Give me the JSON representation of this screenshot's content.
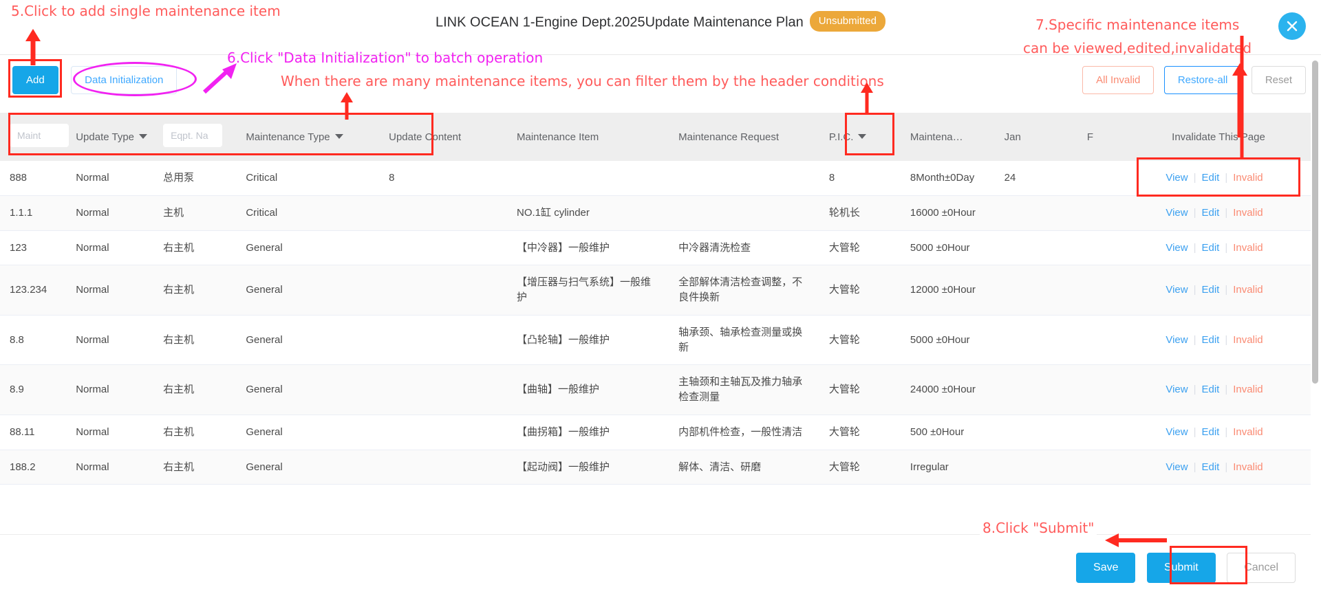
{
  "header": {
    "title": "LINK OCEAN 1-Engine Dept.2025Update Maintenance Plan",
    "status_badge": "Unsubmitted",
    "close_icon": "close-icon"
  },
  "toolbar": {
    "add_label": "Add",
    "data_init_label": "Data Initialization",
    "all_invalid_label": "All Invalid",
    "restore_all_label": "Restore-all",
    "reset_label": "Reset"
  },
  "table": {
    "headers": [
      {
        "label": "Maint",
        "type": "input",
        "placeholder": "Maint"
      },
      {
        "label": "Update Type",
        "type": "dropdown"
      },
      {
        "label": "Eqpt. Na",
        "type": "input",
        "placeholder": "Eqpt. Na"
      },
      {
        "label": "Maintenance Type",
        "type": "dropdown"
      },
      {
        "label": "Update Content",
        "type": "text"
      },
      {
        "label": "Maintenance Item",
        "type": "text"
      },
      {
        "label": "Maintenance Request",
        "type": "text"
      },
      {
        "label": "P.I.C.",
        "type": "dropdown"
      },
      {
        "label": "Maintena…",
        "type": "text"
      },
      {
        "label": "Jan",
        "type": "text"
      },
      {
        "label": "F",
        "type": "text"
      },
      {
        "label": "Invalidate This Page",
        "type": "action"
      }
    ],
    "action_labels": {
      "view": "View",
      "edit": "Edit",
      "invalid": "Invalid"
    },
    "rows": [
      {
        "id": "888",
        "update_type": "Normal",
        "eqpt": "总用泵",
        "maint_type": "Critical",
        "maint_type_critical": true,
        "update_content": "8",
        "maint_item": "",
        "maint_request": "",
        "pic": "8",
        "interval": "8Month±0Day",
        "jan": "24",
        "feb": ""
      },
      {
        "id": "1.1.1",
        "update_type": "Normal",
        "eqpt": "主机",
        "maint_type": "Critical",
        "maint_type_critical": true,
        "update_content": "",
        "maint_item": "NO.1缸 cylinder",
        "maint_request": "",
        "pic": "轮机长",
        "interval": "16000 ±0Hour",
        "jan": "",
        "feb": ""
      },
      {
        "id": "123",
        "update_type": "Normal",
        "eqpt": "右主机",
        "maint_type": "General",
        "maint_type_critical": false,
        "update_content": "",
        "maint_item": "【中冷器】一般维护",
        "maint_request": "中冷器清洗检查",
        "pic": "大管轮",
        "interval": "5000 ±0Hour",
        "jan": "",
        "feb": ""
      },
      {
        "id": "123.234",
        "update_type": "Normal",
        "eqpt": "右主机",
        "maint_type": "General",
        "maint_type_critical": false,
        "update_content": "",
        "maint_item": "【增压器与扫气系统】一般维护",
        "maint_request": "全部解体清洁检查调整，不良件换新",
        "pic": "大管轮",
        "interval": "12000 ±0Hour",
        "jan": "",
        "feb": ""
      },
      {
        "id": "8.8",
        "update_type": "Normal",
        "eqpt": "右主机",
        "maint_type": "General",
        "maint_type_critical": false,
        "update_content": "",
        "maint_item": "【凸轮轴】一般维护",
        "maint_request": "轴承颈、轴承检查测量或换新",
        "pic": "大管轮",
        "interval": "5000 ±0Hour",
        "jan": "",
        "feb": ""
      },
      {
        "id": "8.9",
        "update_type": "Normal",
        "eqpt": "右主机",
        "maint_type": "General",
        "maint_type_critical": false,
        "update_content": "",
        "maint_item": "【曲轴】一般维护",
        "maint_request": "主轴颈和主轴瓦及推力轴承检查测量",
        "pic": "大管轮",
        "interval": "24000 ±0Hour",
        "jan": "",
        "feb": ""
      },
      {
        "id": "88.11",
        "update_type": "Normal",
        "eqpt": "右主机",
        "maint_type": "General",
        "maint_type_critical": false,
        "update_content": "",
        "maint_item": "【曲拐箱】一般维护",
        "maint_request": "内部机件检查，一般性清洁",
        "pic": "大管轮",
        "interval": "500 ±0Hour",
        "jan": "",
        "feb": ""
      },
      {
        "id": "188.2",
        "update_type": "Normal",
        "eqpt": "右主机",
        "maint_type": "General",
        "maint_type_critical": false,
        "update_content": "",
        "maint_item": "【起动阀】一般维护",
        "maint_request": "解体、清洁、研磨",
        "pic": "大管轮",
        "interval": "Irregular",
        "jan": "",
        "feb": ""
      }
    ]
  },
  "footer": {
    "save_label": "Save",
    "submit_label": "Submit",
    "cancel_label": "Cancel"
  },
  "annotations": {
    "step5": "5.Click to add single maintenance item",
    "step6": "6.Click \"Data Initialization\" to batch operation",
    "filter_hint": "When there are many maintenance items, you can filter them by the header conditions",
    "step7_line1": "7.Specific maintenance items",
    "step7_line2": "can be viewed,edited,invalidated",
    "step8": "8.Click \"Submit\""
  },
  "colors": {
    "accent_blue": "#16A6E8",
    "link_blue": "#3BA0F0",
    "danger_orange": "#FA8A72",
    "critical_red": "#F13B2F",
    "badge_orange": "#ECA83A",
    "anno_red": "#FF5B5B",
    "anno_magenta": "#F122F1"
  }
}
